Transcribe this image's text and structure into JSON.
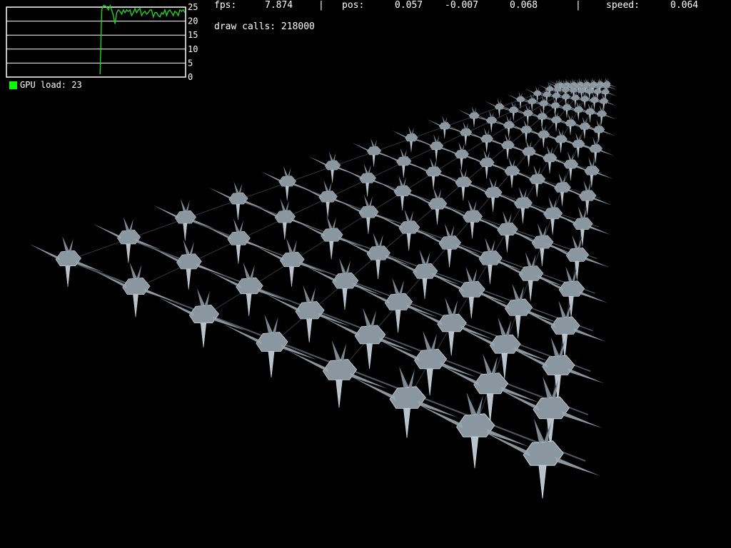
{
  "colors": {
    "background": "#000000",
    "text": "#ffffff",
    "gpu_line": "#21d321",
    "legend_swatch": "#00ff00",
    "ship": "#8a96a0"
  },
  "hud": {
    "fps_label": "fps:",
    "fps_value": "7.874",
    "sep1": "|",
    "pos_label": "pos:",
    "pos_x": "0.057",
    "pos_y": "-0.007",
    "pos_z": "0.068",
    "sep2": "|",
    "speed_label": "speed:",
    "speed_value": "0.064",
    "draw_calls": "draw calls: 218000"
  },
  "gpu_graph": {
    "legend_text": "GPU load: 23",
    "ticks": [
      "25",
      "20",
      "15",
      "10",
      "5",
      "0"
    ]
  },
  "chart_data": {
    "type": "line",
    "title": "",
    "series": [
      {
        "name": "GPU load: 23",
        "values": [
          1,
          24,
          25.5,
          25.5,
          25,
          24,
          25.5,
          24,
          22,
          19,
          23,
          24,
          23.5,
          22.5,
          24,
          23,
          24,
          23.5,
          24,
          22,
          23,
          24.5,
          23,
          24,
          24.5,
          22,
          23,
          23.5,
          22.5,
          23,
          24,
          24,
          21.5,
          23,
          23,
          22,
          21.5,
          23,
          22.5,
          24,
          22,
          23.5,
          24,
          23,
          22,
          23.5,
          23,
          22,
          24,
          23.5,
          24,
          23
        ]
      }
    ],
    "ylim": [
      0,
      25
    ],
    "grid": true
  },
  "scene": {
    "object_type": "spaceship-grid"
  }
}
